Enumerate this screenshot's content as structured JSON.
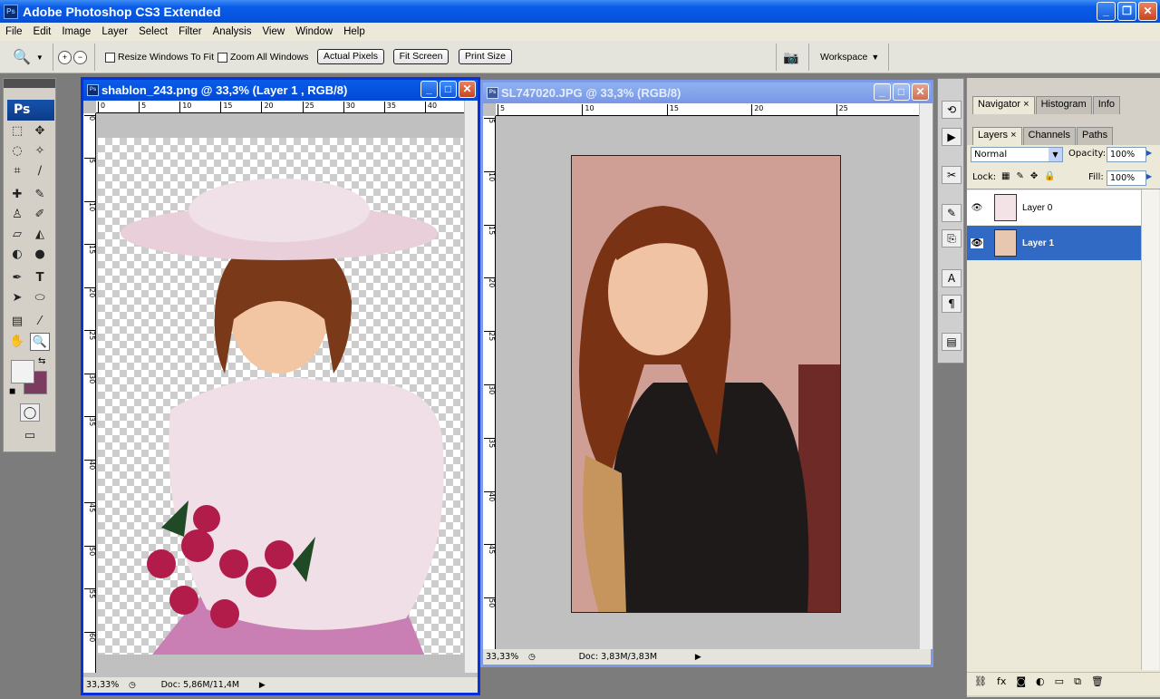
{
  "app": {
    "title": "Adobe Photoshop CS3 Extended",
    "icon_label": "Ps"
  },
  "menu": [
    "File",
    "Edit",
    "Image",
    "Layer",
    "Select",
    "Filter",
    "Analysis",
    "View",
    "Window",
    "Help"
  ],
  "options": {
    "resize_windows": "Resize Windows To Fit",
    "zoom_all": "Zoom All Windows",
    "actual_pixels": "Actual Pixels",
    "fit_screen": "Fit Screen",
    "print_size": "Print Size",
    "workspace": "Workspace"
  },
  "toolbox": {
    "logo": "Ps"
  },
  "doc1": {
    "title": "shablon_243.png @ 33,3% (Layer 1 , RGB/8)",
    "zoom": "33,33%",
    "doc": "Doc: 5,86M/11,4M",
    "ruler_h": [
      "0",
      "5",
      "10",
      "15",
      "20",
      "25",
      "30",
      "35",
      "40"
    ],
    "ruler_v": [
      "0",
      "5",
      "10",
      "15",
      "20",
      "25",
      "30",
      "35",
      "40",
      "45",
      "50",
      "55",
      "60"
    ]
  },
  "doc2": {
    "title": "SL747020.JPG @ 33,3% (RGB/8)",
    "zoom": "33,33%",
    "doc": "Doc: 3,83M/3,83M",
    "ruler_h": [
      "5",
      "10",
      "15",
      "20",
      "25"
    ],
    "ruler_v": [
      "5",
      "10",
      "15",
      "20",
      "25",
      "30",
      "35",
      "40",
      "45",
      "50"
    ]
  },
  "panels": {
    "top_tabs": [
      "Navigator",
      "Histogram",
      "Info"
    ],
    "layer_tabs": [
      "Layers",
      "Channels",
      "Paths"
    ],
    "blend_mode": "Normal",
    "opacity_label": "Opacity:",
    "opacity": "100%",
    "lock_label": "Lock:",
    "fill_label": "Fill:",
    "fill": "100%",
    "layers": [
      {
        "name": "Layer 0",
        "selected": false
      },
      {
        "name": "Layer 1",
        "selected": true
      }
    ]
  },
  "colors": {
    "selection": "#316ac5",
    "bg_swatch": "#7b3d5f",
    "fg_swatch": "#f2f2f2"
  }
}
